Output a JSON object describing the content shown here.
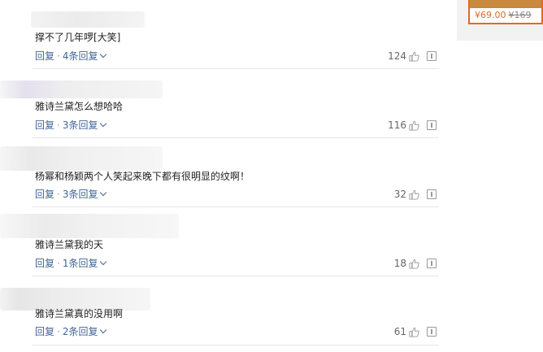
{
  "comments": [
    {
      "text": "撑不了几年啰[大笑]",
      "reply_label": "回复",
      "sep": "·",
      "reply_count": "4条回复",
      "likes": "124"
    },
    {
      "text": "雅诗兰黛怎么想哈哈",
      "reply_label": "回复",
      "sep": "·",
      "reply_count": "3条回复",
      "likes": "116"
    },
    {
      "text": "杨幂和杨颖两个人笑起来晚下都有很明显的纹啊！",
      "reply_label": "回复",
      "sep": "·",
      "reply_count": "3条回复",
      "likes": "32"
    },
    {
      "text": "雅诗兰黛我的天",
      "reply_label": "回复",
      "sep": "·",
      "reply_count": "1条回复",
      "likes": "18"
    },
    {
      "text": "雅诗兰黛真的没用啊",
      "reply_label": "回复",
      "sep": "·",
      "reply_count": "2条回复",
      "likes": "61"
    }
  ],
  "ad": {
    "price": "¥69.00",
    "old_price": "¥169"
  },
  "colors": {
    "link": "#406599",
    "accent": "#e26a1f",
    "divider": "#e6e6e6"
  },
  "icons": {
    "like": "thumbs-up-icon",
    "report": "report-icon",
    "expand": "chevron-down-icon"
  }
}
